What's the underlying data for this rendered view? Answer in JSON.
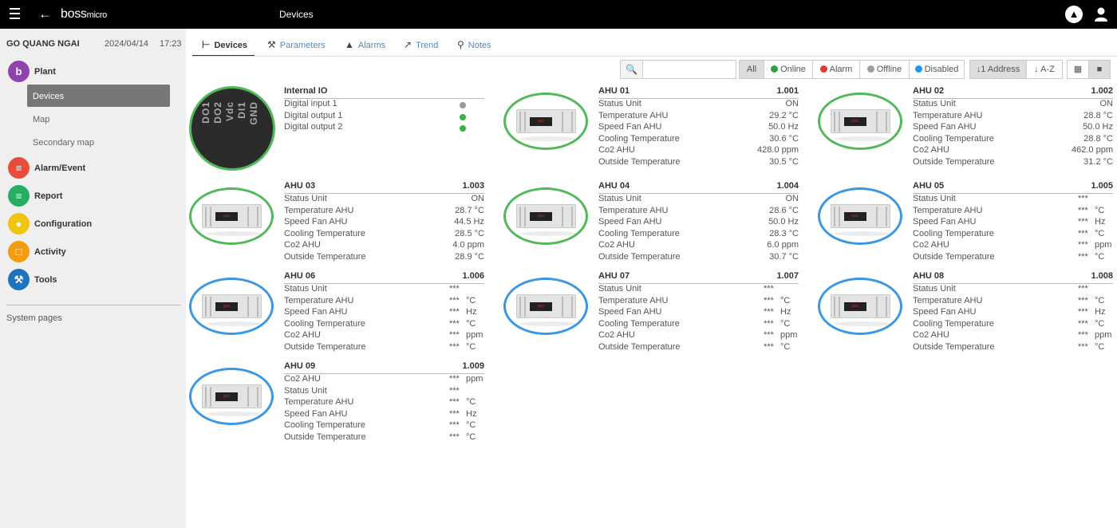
{
  "header": {
    "logo_main": "boss",
    "logo_sub": "micro",
    "page_title": "Devices"
  },
  "sidebar": {
    "site_name": "GO QUANG NGAI",
    "date": "2024/04/14",
    "time": "17:23",
    "sections": [
      {
        "label": "Plant",
        "icon": "plant-icon",
        "color": "#8e44ad"
      },
      {
        "label": "Alarm/Event",
        "icon": "alarm-list-icon",
        "color": "#e74c3c"
      },
      {
        "label": "Report",
        "icon": "report-icon",
        "color": "#27ae60"
      },
      {
        "label": "Configuration",
        "icon": "configuration-icon",
        "color": "#f1c40f"
      },
      {
        "label": "Activity",
        "icon": "calendar-icon",
        "color": "#f39c12"
      },
      {
        "label": "Tools",
        "icon": "wrench-icon",
        "color": "#1e73be"
      }
    ],
    "plant_items": [
      "Devices",
      "Map",
      "Secondary map"
    ],
    "system_pages": "System pages"
  },
  "tabs": [
    {
      "label": "Devices",
      "icon": "devices-icon"
    },
    {
      "label": "Parameters",
      "icon": "wrench-icon"
    },
    {
      "label": "Alarms",
      "icon": "bell-icon"
    },
    {
      "label": "Trend",
      "icon": "chart-icon"
    },
    {
      "label": "Notes",
      "icon": "pin-icon"
    }
  ],
  "toolbar": {
    "search_placeholder": "",
    "filters": {
      "all": "All",
      "online": "Online",
      "alarm": "Alarm",
      "offline": "Offline",
      "disabled": "Disabled"
    },
    "status_colors": {
      "online": "#2ea043",
      "alarm": "#e53935",
      "offline": "#9e9e9e",
      "disabled": "#2196f3"
    },
    "sort_address": "Address",
    "sort_az": "A-Z"
  },
  "internal_io": {
    "title": "Internal IO",
    "image_labels": [
      "DO1",
      "DO2",
      "Vdc",
      "DI1",
      "GND"
    ],
    "rows": [
      {
        "name": "Digital input 1",
        "state": "gray"
      },
      {
        "name": "Digital output 1",
        "state": "green"
      },
      {
        "name": "Digital output 2",
        "state": "green"
      }
    ]
  },
  "devices": [
    {
      "name": "AHU 01",
      "address": "1.001",
      "status": "online",
      "rows": [
        {
          "label": "Status Unit",
          "value": "ON",
          "unit": ""
        },
        {
          "label": "Temperature AHU",
          "value": "29.2",
          "unit": "°C"
        },
        {
          "label": "Speed Fan AHU",
          "value": "50.0",
          "unit": "Hz"
        },
        {
          "label": "Cooling Temperature",
          "value": "30.6",
          "unit": "°C"
        },
        {
          "label": "Co2 AHU",
          "value": "428.0",
          "unit": "ppm"
        },
        {
          "label": "Outside Temperature",
          "value": "30.5",
          "unit": "°C"
        }
      ]
    },
    {
      "name": "AHU 02",
      "address": "1.002",
      "status": "online",
      "rows": [
        {
          "label": "Status Unit",
          "value": "ON",
          "unit": ""
        },
        {
          "label": "Temperature AHU",
          "value": "28.8",
          "unit": "°C"
        },
        {
          "label": "Speed Fan AHU",
          "value": "50.0",
          "unit": "Hz"
        },
        {
          "label": "Cooling Temperature",
          "value": "28.8",
          "unit": "°C"
        },
        {
          "label": "Co2 AHU",
          "value": "462.0",
          "unit": "ppm"
        },
        {
          "label": "Outside Temperature",
          "value": "31.2",
          "unit": "°C"
        }
      ]
    },
    {
      "name": "AHU 03",
      "address": "1.003",
      "status": "online",
      "rows": [
        {
          "label": "Status Unit",
          "value": "ON",
          "unit": ""
        },
        {
          "label": "Temperature AHU",
          "value": "28.7",
          "unit": "°C"
        },
        {
          "label": "Speed Fan AHU",
          "value": "44.5",
          "unit": "Hz"
        },
        {
          "label": "Cooling Temperature",
          "value": "28.5",
          "unit": "°C"
        },
        {
          "label": "Co2 AHU",
          "value": "4.0",
          "unit": "ppm"
        },
        {
          "label": "Outside Temperature",
          "value": "28.9",
          "unit": "°C"
        }
      ]
    },
    {
      "name": "AHU 04",
      "address": "1.004",
      "status": "online",
      "rows": [
        {
          "label": "Status Unit",
          "value": "ON",
          "unit": ""
        },
        {
          "label": "Temperature AHU",
          "value": "28.6",
          "unit": "°C"
        },
        {
          "label": "Speed Fan AHU",
          "value": "50.0",
          "unit": "Hz"
        },
        {
          "label": "Cooling Temperature",
          "value": "28.3",
          "unit": "°C"
        },
        {
          "label": "Co2 AHU",
          "value": "6.0",
          "unit": "ppm"
        },
        {
          "label": "Outside Temperature",
          "value": "30.7",
          "unit": "°C"
        }
      ]
    },
    {
      "name": "AHU 05",
      "address": "1.005",
      "status": "disabled",
      "rows": [
        {
          "label": "Status Unit",
          "value": "***",
          "unit": ""
        },
        {
          "label": "Temperature AHU",
          "value": "***",
          "unit": "°C"
        },
        {
          "label": "Speed Fan AHU",
          "value": "***",
          "unit": "Hz"
        },
        {
          "label": "Cooling Temperature",
          "value": "***",
          "unit": "°C"
        },
        {
          "label": "Co2 AHU",
          "value": "***",
          "unit": "ppm"
        },
        {
          "label": "Outside Temperature",
          "value": "***",
          "unit": "°C"
        }
      ]
    },
    {
      "name": "AHU 06",
      "address": "1.006",
      "status": "disabled",
      "rows": [
        {
          "label": "Status Unit",
          "value": "***",
          "unit": ""
        },
        {
          "label": "Temperature AHU",
          "value": "***",
          "unit": "°C"
        },
        {
          "label": "Speed Fan AHU",
          "value": "***",
          "unit": "Hz"
        },
        {
          "label": "Cooling Temperature",
          "value": "***",
          "unit": "°C"
        },
        {
          "label": "Co2 AHU",
          "value": "***",
          "unit": "ppm"
        },
        {
          "label": "Outside Temperature",
          "value": "***",
          "unit": "°C"
        }
      ]
    },
    {
      "name": "AHU 07",
      "address": "1.007",
      "status": "disabled",
      "rows": [
        {
          "label": "Status Unit",
          "value": "***",
          "unit": ""
        },
        {
          "label": "Temperature AHU",
          "value": "***",
          "unit": "°C"
        },
        {
          "label": "Speed Fan AHU",
          "value": "***",
          "unit": "Hz"
        },
        {
          "label": "Cooling Temperature",
          "value": "***",
          "unit": "°C"
        },
        {
          "label": "Co2 AHU",
          "value": "***",
          "unit": "ppm"
        },
        {
          "label": "Outside Temperature",
          "value": "***",
          "unit": "°C"
        }
      ]
    },
    {
      "name": "AHU 08",
      "address": "1.008",
      "status": "disabled",
      "rows": [
        {
          "label": "Status Unit",
          "value": "***",
          "unit": ""
        },
        {
          "label": "Temperature AHU",
          "value": "***",
          "unit": "°C"
        },
        {
          "label": "Speed Fan AHU",
          "value": "***",
          "unit": "Hz"
        },
        {
          "label": "Cooling Temperature",
          "value": "***",
          "unit": "°C"
        },
        {
          "label": "Co2 AHU",
          "value": "***",
          "unit": "ppm"
        },
        {
          "label": "Outside Temperature",
          "value": "***",
          "unit": "°C"
        }
      ]
    },
    {
      "name": "AHU 09",
      "address": "1.009",
      "status": "disabled",
      "rows": [
        {
          "label": "Co2 AHU",
          "value": "***",
          "unit": "ppm"
        },
        {
          "label": "Status Unit",
          "value": "***",
          "unit": ""
        },
        {
          "label": "Temperature AHU",
          "value": "***",
          "unit": "°C"
        },
        {
          "label": "Speed Fan AHU",
          "value": "***",
          "unit": "Hz"
        },
        {
          "label": "Cooling Temperature",
          "value": "***",
          "unit": "°C"
        },
        {
          "label": "Outside Temperature",
          "value": "***",
          "unit": "°C"
        }
      ]
    }
  ]
}
